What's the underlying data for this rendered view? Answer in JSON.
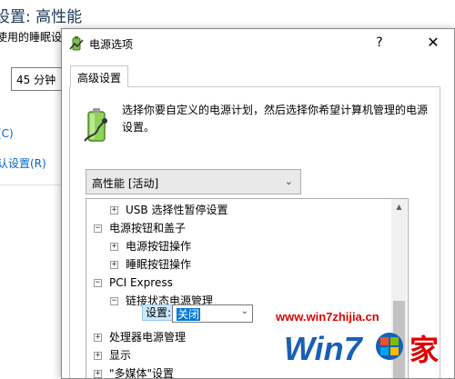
{
  "background_window": {
    "title": "设置: 高性能",
    "subtitle": "使用的睡眠设",
    "sleep_value": "45 分钟",
    "link1": "(C)",
    "link2": "认设置(R)"
  },
  "dialog": {
    "title": "电源选项",
    "help": "?",
    "close": "✕",
    "tab": "高级设置",
    "description": "选择你要自定义的电源计划，然后选择你希望计算机管理的电源设置。",
    "plan_selected": "高性能 [活动]",
    "tree": [
      {
        "expander": "+",
        "label": "USB 选择性暂停设置",
        "level": 2
      },
      {
        "expander": "−",
        "label": "电源按钮和盖子",
        "level": 1
      },
      {
        "expander": "+",
        "label": "电源按钮操作",
        "level": 2
      },
      {
        "expander": "+",
        "label": "睡眠按钮操作",
        "level": 2
      },
      {
        "expander": "−",
        "label": "PCI Express",
        "level": 1
      },
      {
        "expander": "−",
        "label": "链接状态电源管理",
        "level": 2
      },
      {
        "expander": "",
        "label": "",
        "level": 3
      },
      {
        "expander": "+",
        "label": "处理器电源管理",
        "level": 1
      },
      {
        "expander": "+",
        "label": "显示",
        "level": 1
      },
      {
        "expander": "+",
        "label": "\"多媒体\"设置",
        "level": 1
      }
    ],
    "setting_label": "设置:",
    "setting_value": "关闭"
  },
  "watermark": {
    "url": "www.win7zhijia.cn",
    "logo_text": "Win7",
    "logo_suffix": "家"
  },
  "colors": {
    "accent": "#0078d7",
    "watermark_red": "#e00000",
    "watermark_blue": "#1a5fb4",
    "selection_bg": "#cce8ff"
  }
}
